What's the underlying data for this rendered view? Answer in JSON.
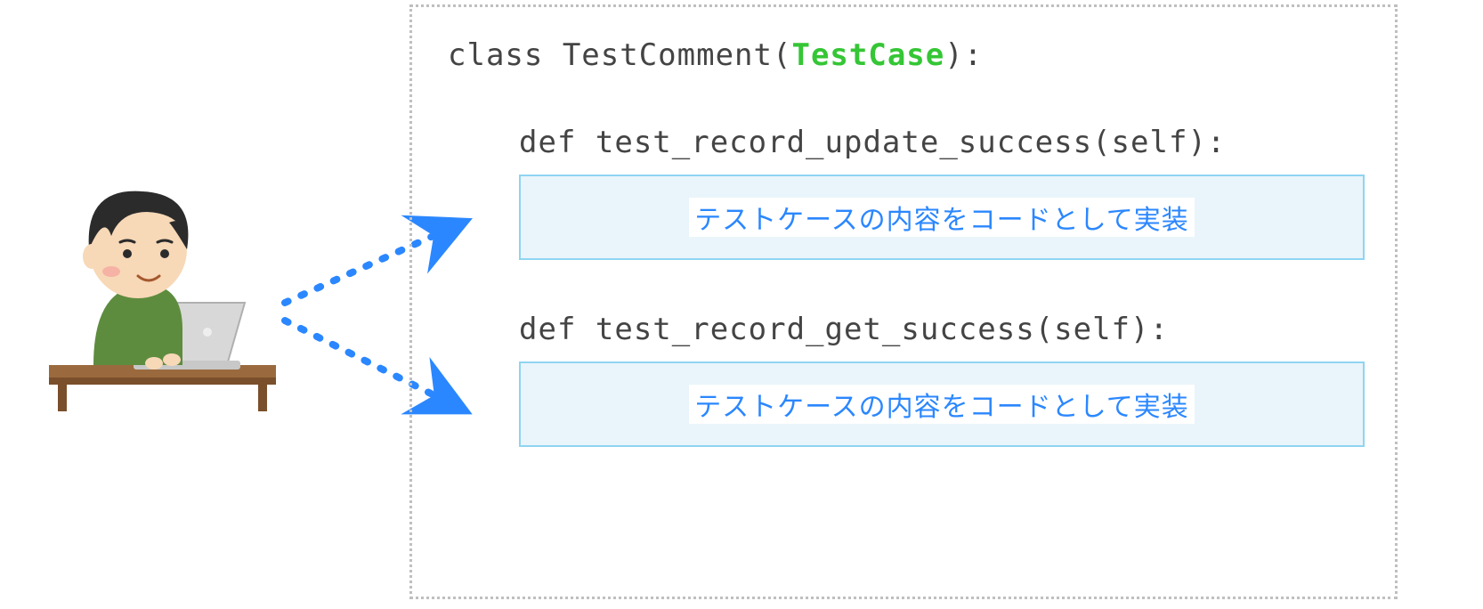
{
  "code": {
    "class_keyword": "class ",
    "class_name": "TestComment(",
    "base_class": "TestCase",
    "class_close": "):",
    "def1": "def test_record_update_success(self):",
    "def2": "def test_record_get_success(self):"
  },
  "body_label": "テストケースの内容をコードとして実装",
  "colors": {
    "arrow": "#2b87ff",
    "box_border": "#8fd4f2",
    "box_fill": "#e9f5fb",
    "code_green": "#35c635"
  }
}
